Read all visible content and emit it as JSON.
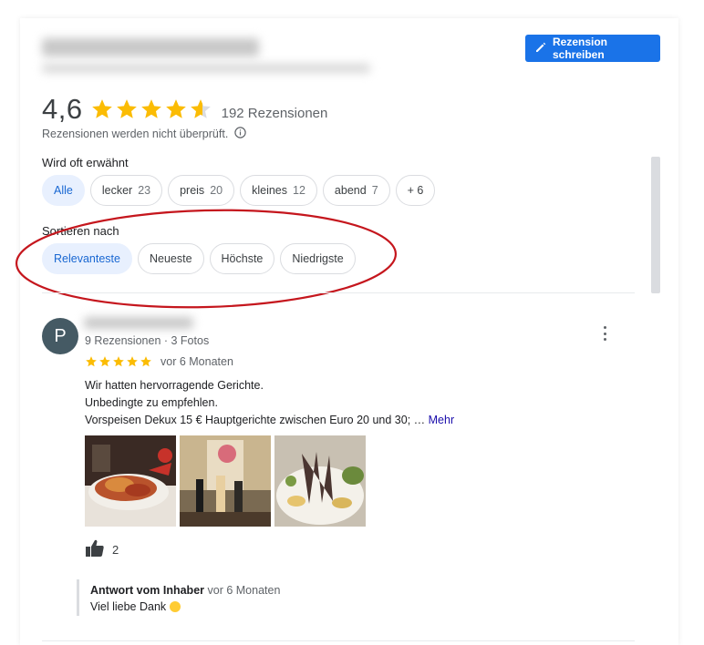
{
  "header": {
    "write_review_label": "Rezension schreiben"
  },
  "rating": {
    "score": "4,6",
    "stars": 4.6,
    "count_label": "192 Rezensionen",
    "note": "Rezensionen werden nicht überprüft."
  },
  "topics": {
    "label": "Wird oft erwähnt",
    "chips": [
      {
        "label": "Alle",
        "count": ""
      },
      {
        "label": "lecker",
        "count": "23"
      },
      {
        "label": "preis",
        "count": "20"
      },
      {
        "label": "kleines",
        "count": "12"
      },
      {
        "label": "abend",
        "count": "7"
      },
      {
        "label": "+ 6",
        "count": ""
      }
    ]
  },
  "sort": {
    "label": "Sortieren nach",
    "options": [
      "Relevanteste",
      "Neueste",
      "Höchste",
      "Niedrigste"
    ],
    "selected": "Relevanteste"
  },
  "review": {
    "avatar_letter": "P",
    "meta": "9 Rezensionen · 3 Fotos",
    "stars": 5,
    "date": "vor 6 Monaten",
    "lines": [
      "Wir hatten hervorragende Gerichte.",
      "Unbedingte zu empfehlen.",
      "Vorspeisen Dekux 15 € Hauptgerichte zwischen Euro 20 und 30; …"
    ],
    "more_label": "Mehr",
    "likes": "2",
    "reply": {
      "title": "Antwort vom Inhaber",
      "date": "vor 6 Monaten",
      "text": "Viel liebe Dank"
    }
  },
  "colors": {
    "accent": "#1a73e8",
    "star": "#fbbc04",
    "annotation": "#c5161d"
  }
}
